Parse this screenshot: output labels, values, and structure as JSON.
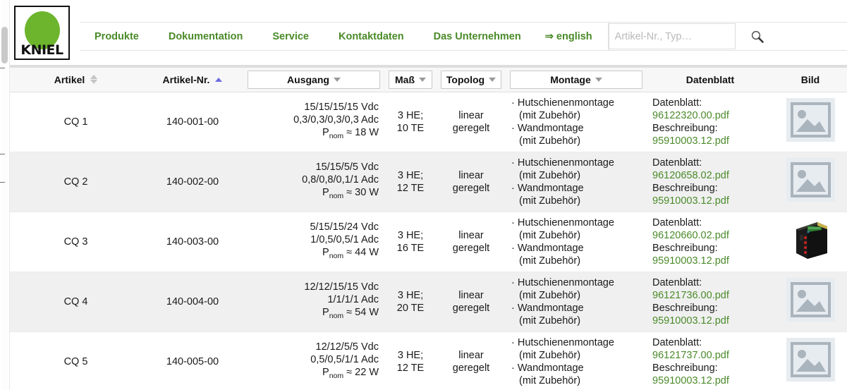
{
  "brand": {
    "name": "KNIEL",
    "logo_color": "#6cb52d"
  },
  "nav": {
    "items": [
      {
        "label": "Produkte"
      },
      {
        "label": "Dokumentation"
      },
      {
        "label": "Service"
      },
      {
        "label": "Kontaktdaten"
      },
      {
        "label": "Das Unternehmen"
      }
    ],
    "language_link": "⇒ english"
  },
  "search": {
    "placeholder": "Artikel-Nr., Typ…",
    "value": "",
    "icon": "search-icon"
  },
  "table": {
    "columns": [
      {
        "label": "Artikel",
        "control": "sort",
        "sort_state": "none"
      },
      {
        "label": "Artikel-Nr.",
        "control": "sort",
        "sort_state": "asc"
      },
      {
        "label": "Ausgang",
        "control": "select"
      },
      {
        "label": "Maß",
        "control": "select"
      },
      {
        "label": "Topolog",
        "control": "select"
      },
      {
        "label": "Montage",
        "control": "select"
      },
      {
        "label": "Datenblatt",
        "control": "none"
      },
      {
        "label": "Bild",
        "control": "none"
      }
    ],
    "labels": {
      "datenblatt": "Datenblatt:",
      "beschreibung": "Beschreibung:"
    },
    "rows": [
      {
        "artikel": "CQ 1",
        "artikel_nr": "140-001-00",
        "ausgang_v": "15/15/15/15 Vdc",
        "ausgang_a": "0,3/0,3/0,3/0,3 Adc",
        "ausgang_p_prefix": "P",
        "ausgang_p_sub": "nom",
        "ausgang_p_value": "≈ 18 W",
        "mass_1": "3 HE;",
        "mass_2": "10 TE",
        "topologie_1": "linear",
        "topologie_2": "geregelt",
        "montage_1": "· Hutschienenmontage",
        "montage_1_sub": "(mit Zubehör)",
        "montage_2": "· Wandmontage",
        "montage_2_sub": "(mit Zubehör)",
        "datenblatt_file": "96122320.00.pdf",
        "beschreibung_file": "95910003.12.pdf",
        "bild": "placeholder"
      },
      {
        "artikel": "CQ 2",
        "artikel_nr": "140-002-00",
        "ausgang_v": "15/15/5/5 Vdc",
        "ausgang_a": "0,8/0,8/0,1/1 Adc",
        "ausgang_p_prefix": "P",
        "ausgang_p_sub": "nom",
        "ausgang_p_value": "≈ 30 W",
        "mass_1": "3 HE;",
        "mass_2": "12 TE",
        "topologie_1": "linear",
        "topologie_2": "geregelt",
        "montage_1": "· Hutschienenmontage",
        "montage_1_sub": "(mit Zubehör)",
        "montage_2": "· Wandmontage",
        "montage_2_sub": "(mit Zubehör)",
        "datenblatt_file": "96120658.02.pdf",
        "beschreibung_file": "95910003.12.pdf",
        "bild": "placeholder"
      },
      {
        "artikel": "CQ 3",
        "artikel_nr": "140-003-00",
        "ausgang_v": "5/15/15/24 Vdc",
        "ausgang_a": "1/0,5/0,5/1 Adc",
        "ausgang_p_prefix": "P",
        "ausgang_p_sub": "nom",
        "ausgang_p_value": "≈ 44 W",
        "mass_1": "3 HE;",
        "mass_2": "16 TE",
        "topologie_1": "linear",
        "topologie_2": "geregelt",
        "montage_1": "· Hutschienenmontage",
        "montage_1_sub": "(mit Zubehör)",
        "montage_2": "· Wandmontage",
        "montage_2_sub": "(mit Zubehör)",
        "datenblatt_file": "96120660.02.pdf",
        "beschreibung_file": "95910003.12.pdf",
        "bild": "product-photo"
      },
      {
        "artikel": "CQ 4",
        "artikel_nr": "140-004-00",
        "ausgang_v": "12/12/15/15 Vdc",
        "ausgang_a": "1/1/1/1 Adc",
        "ausgang_p_prefix": "P",
        "ausgang_p_sub": "nom",
        "ausgang_p_value": "≈ 54 W",
        "mass_1": "3 HE;",
        "mass_2": "20 TE",
        "topologie_1": "linear",
        "topologie_2": "geregelt",
        "montage_1": "· Hutschienenmontage",
        "montage_1_sub": "(mit Zubehör)",
        "montage_2": "· Wandmontage",
        "montage_2_sub": "(mit Zubehör)",
        "datenblatt_file": "96121736.00.pdf",
        "beschreibung_file": "95910003.12.pdf",
        "bild": "placeholder"
      },
      {
        "artikel": "CQ 5",
        "artikel_nr": "140-005-00",
        "ausgang_v": "12/12/5/5 Vdc",
        "ausgang_a": "0,5/0,5/1/1 Adc",
        "ausgang_p_prefix": "P",
        "ausgang_p_sub": "nom",
        "ausgang_p_value": "≈ 22 W",
        "mass_1": "3 HE;",
        "mass_2": "12 TE",
        "topologie_1": "linear",
        "topologie_2": "geregelt",
        "montage_1": "· Hutschienenmontage",
        "montage_1_sub": "(mit Zubehör)",
        "montage_2": "· Wandmontage",
        "montage_2_sub": "(mit Zubehör)",
        "datenblatt_file": "96121737.00.pdf",
        "beschreibung_file": "95910003.12.pdf",
        "bild": "placeholder"
      }
    ]
  },
  "colors": {
    "brand_green": "#4a8a29",
    "link_green": "#4a8a29",
    "sort_active": "#6b6be0"
  }
}
